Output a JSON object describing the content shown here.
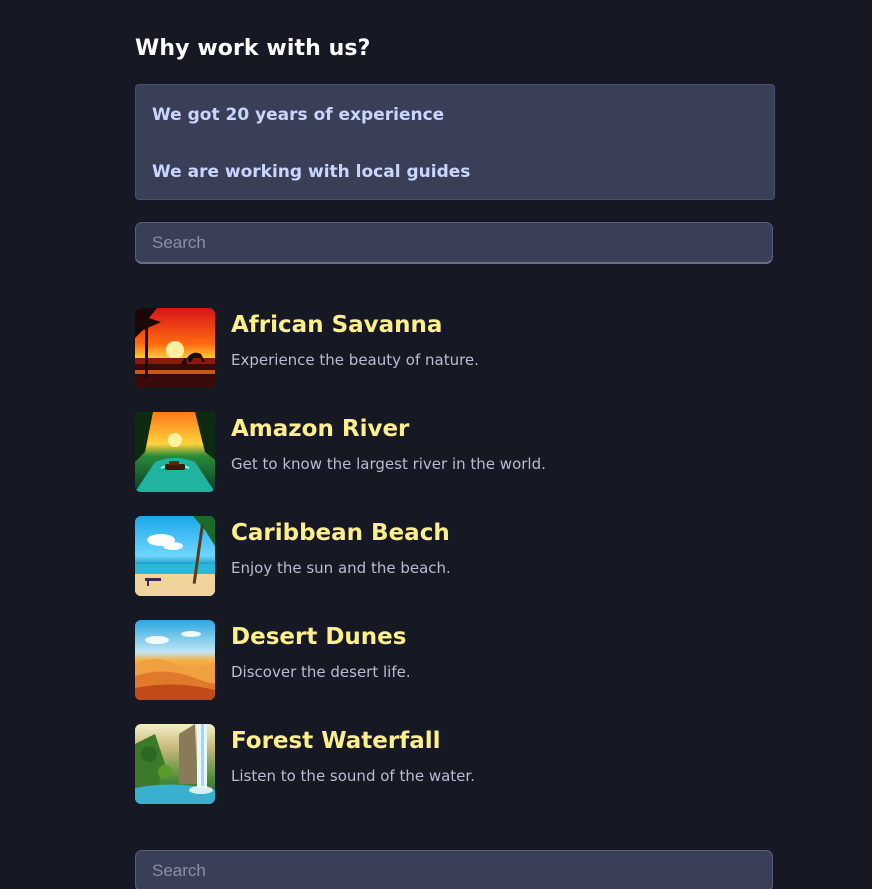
{
  "why": {
    "title": "Why work with us?",
    "items": [
      "We got 20 years of experience",
      "We are working with local guides"
    ]
  },
  "search": {
    "top_placeholder": "Search",
    "bottom_placeholder": "Search"
  },
  "destinations": [
    {
      "title": "African Savanna",
      "description": "Experience the beauty of nature.",
      "image_icon": "savanna-sunset-image"
    },
    {
      "title": "Amazon River",
      "description": "Get to know the largest river in the world.",
      "image_icon": "jungle-river-image"
    },
    {
      "title": "Caribbean Beach",
      "description": "Enjoy the sun and the beach.",
      "image_icon": "tropical-beach-image"
    },
    {
      "title": "Desert Dunes",
      "description": "Discover the desert life.",
      "image_icon": "desert-dunes-image"
    },
    {
      "title": "Forest Waterfall",
      "description": "Listen to the sound of the water.",
      "image_icon": "forest-waterfall-image"
    }
  ],
  "colors": {
    "background": "#161923",
    "panel": "#3a3f58",
    "heading": "#ffffff",
    "accent_title": "#fdf08a",
    "why_text": "#c9d7ff",
    "description": "#b9bdd0"
  }
}
